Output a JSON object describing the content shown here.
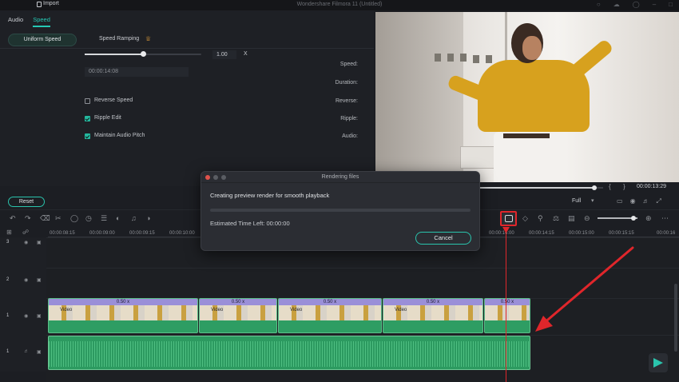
{
  "titlebar": {
    "import_label": "Import",
    "title": "Wondershare Filmora 11 (Untitled)",
    "icons": [
      "lightbulb-icon",
      "cloud-icon",
      "account-icon",
      "minimize-icon",
      "maximize-icon"
    ]
  },
  "panel": {
    "tabs": [
      {
        "label": "Audio",
        "active": false
      },
      {
        "label": "Speed",
        "active": true
      }
    ],
    "subtabs": {
      "uniform": "Uniform Speed",
      "ramping": "Speed Ramping"
    },
    "speed": {
      "label": "Speed:",
      "value": "1.00",
      "unit": "X",
      "slider_position": 0.5
    },
    "duration": {
      "label": "Duration:",
      "value": "00:00:14:08"
    },
    "reverse": {
      "label": "Reverse:",
      "checkbox_label": "Reverse Speed",
      "checked": false
    },
    "ripple": {
      "label": "Ripple:",
      "checkbox_label": "Ripple Edit",
      "checked": true
    },
    "audio": {
      "label": "Audio:",
      "checkbox_label": "Maintain Audio Pitch",
      "checked": true
    },
    "reset_label": "Reset"
  },
  "preview": {
    "time": "00:00:13:29",
    "quality": "Full",
    "progress": 0.93
  },
  "ruler": {
    "ticks": [
      "00:00:08:15",
      "00:00:09:00",
      "00:00:09:15",
      "00:00:10:00",
      "00:00:14:00",
      "00:00:14:15",
      "00:00:15:00",
      "00:00:15:15",
      "00:00:16"
    ]
  },
  "tracks": {
    "video3": "3",
    "video2": "2",
    "video1": "1",
    "audio1": "1"
  },
  "clips": [
    {
      "speed": "0.50 x",
      "name": "Video"
    },
    {
      "speed": "0.50 x",
      "name": "Video"
    },
    {
      "speed": "0.50 x",
      "name": "Video"
    },
    {
      "speed": "0.50 x",
      "name": "Video"
    },
    {
      "speed": "0.50 x",
      "name": ""
    }
  ],
  "dialog": {
    "title": "Rendering files",
    "message": "Creating preview render for smooth playback",
    "estimate": "Estimated Time Left: 00:00:00",
    "cancel_label": "Cancel",
    "progress": 0.0
  },
  "colors": {
    "accent": "#25c8b4",
    "highlight": "#e0262b",
    "clip": "#2e9d63",
    "speed_band": "#9a8fd8"
  }
}
